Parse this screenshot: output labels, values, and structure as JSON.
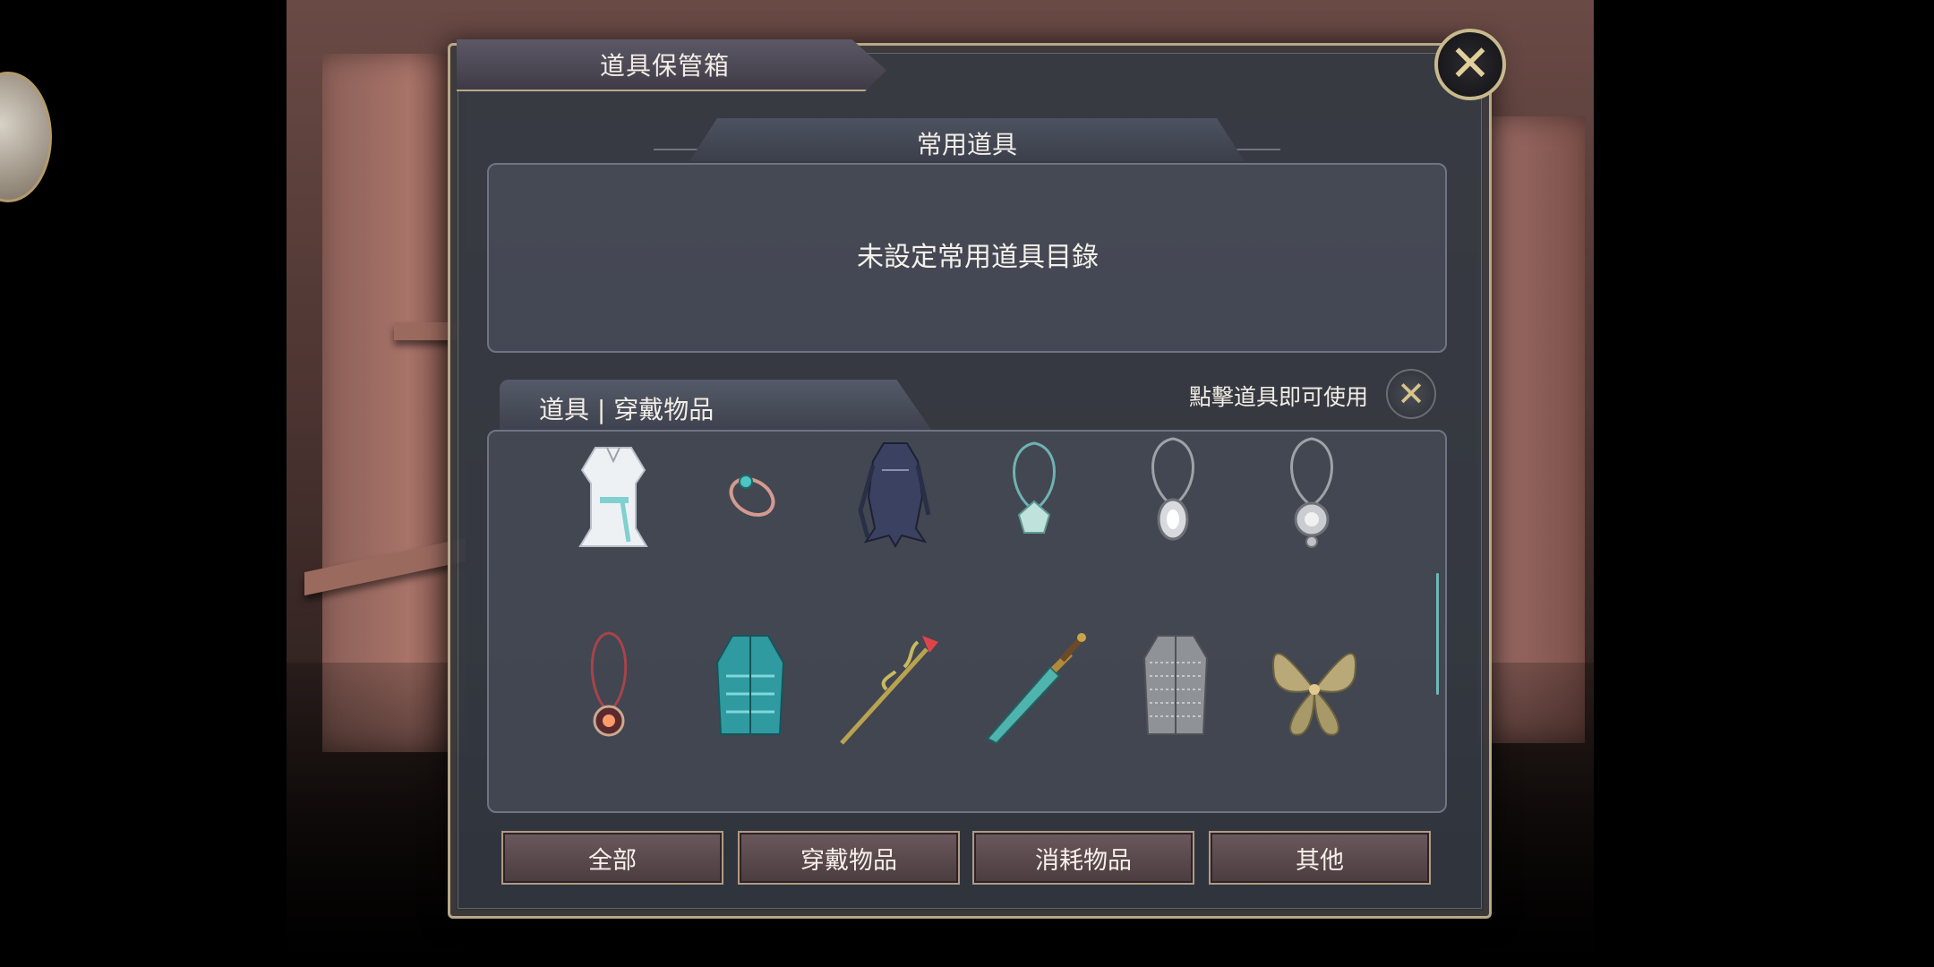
{
  "window": {
    "title": "道具保管箱",
    "close_icon": "close-icon"
  },
  "favorites": {
    "title": "常用道具",
    "empty_text": "未設定常用道具目錄"
  },
  "inventory": {
    "tab_label": "道具 | 穿戴物品",
    "hint": "點擊道具即可使用",
    "hint_icon": "crossed-swords-icon",
    "items": [
      {
        "name": "white-robe"
      },
      {
        "name": "teal-gem-ring"
      },
      {
        "name": "dark-armor"
      },
      {
        "name": "crystal-pendant"
      },
      {
        "name": "silver-amulet"
      },
      {
        "name": "silver-medallion"
      },
      {
        "name": "sun-pendant"
      },
      {
        "name": "teal-feather-vest"
      },
      {
        "name": "vine-staff"
      },
      {
        "name": "jade-sword"
      },
      {
        "name": "chain-mail"
      },
      {
        "name": "leaf-wings"
      }
    ]
  },
  "filters": [
    "全部",
    "穿戴物品",
    "消耗物品",
    "其他"
  ],
  "colors": {
    "frame_gold": "#b7a888",
    "panel_bg": "#343942",
    "button_bg": "#5a4a4e",
    "accent_teal": "#6fb9b6"
  }
}
